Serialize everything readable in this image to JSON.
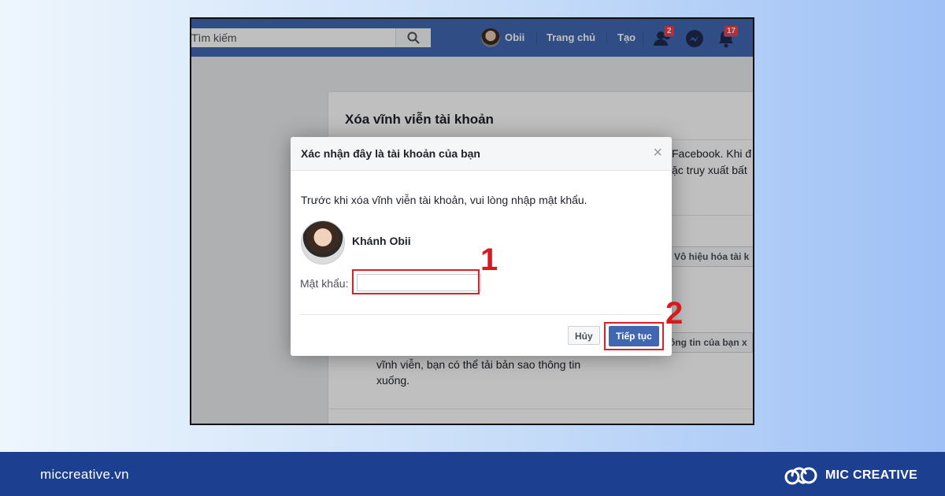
{
  "fb": {
    "search_placeholder": "Tìm kiếm",
    "nav": {
      "profile_name": "Obii",
      "home": "Trang chủ",
      "create": "Tạo",
      "friend_requests_count": "2",
      "notifications_count": "17"
    }
  },
  "background": {
    "title": "Xóa vĩnh viễn tài khoản",
    "text_line1": "Facebook. Khi đ",
    "text_line2": "ặc truy xuất bất",
    "deactivate_button": "Vô hiệu hóa tài k",
    "download_button": "ông tin của bạn x",
    "download_text_1": "vĩnh viễn, bạn có thể tải bản sao thông tin",
    "download_text_2": "xuống."
  },
  "dialog": {
    "title": "Xác nhận đây là tài khoản của bạn",
    "close_symbol": "×",
    "intro": "Trước khi xóa vĩnh viễn tài khoản, vui lòng nhập mật khẩu.",
    "user_name": "Khánh Obii",
    "password_label": "Mật khẩu:",
    "password_value": "",
    "cancel_label": "Hủy",
    "continue_label": "Tiếp tục"
  },
  "annotations": {
    "step1": "1",
    "step2": "2",
    "highlight_color": "#e02020"
  },
  "footer": {
    "website": "miccreative.vn",
    "brand": "MIC CREATIVE",
    "color": "#1d3f8f"
  },
  "colors": {
    "facebook_blue": "#4267b2"
  }
}
